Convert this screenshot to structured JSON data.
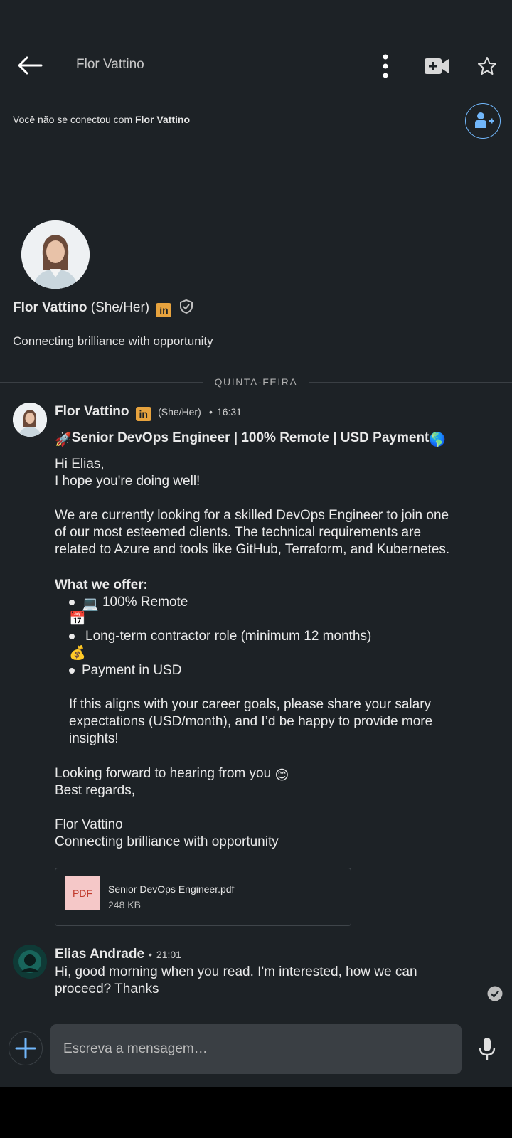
{
  "header": {
    "title": "Flor Vattino",
    "not_connected_prefix": "Você não se conectou com",
    "not_connected_name": "Flor Vattino"
  },
  "profile": {
    "name": "Flor Vattino",
    "pronouns": "(She/Her)",
    "headline": "Connecting brilliance with opportunity"
  },
  "day_label": "QUINTA-FEIRA",
  "message1": {
    "sender": "Flor Vattino",
    "pronouns": "(She/Her)",
    "time": "16:31",
    "subject": "Senior DevOps Engineer | 100% Remote | USD Payment",
    "lines": [
      "Hi Elias,",
      "I hope you're doing well!",
      "We are currently looking for a skilled DevOps Engineer to join one",
      "of our most esteemed clients. The technical requirements are",
      "related to Azure and tools like GitHub, Terraform, and Kubernetes."
    ],
    "offer_heading": "What we offer:",
    "offers": [
      "100% Remote",
      "Long-term contractor role (minimum 12 months)",
      "Payment in USD"
    ],
    "closing_lines": [
      "If this aligns with your career goals, please share your salary",
      "expectations (USD/month), and I’d be happy to provide more",
      "insights!"
    ],
    "signoff": [
      "Looking forward to hearing from you",
      "Best regards,",
      "Flor Vattino",
      "Connecting brilliance with opportunity"
    ]
  },
  "attachment": {
    "type_label": "PDF",
    "filename": "Senior DevOps Engineer.pdf",
    "size": "248 KB"
  },
  "message2": {
    "sender": "Elias Andrade",
    "time": "21:01",
    "lines": [
      "Hi, good morning when you read. I'm interested, how we can",
      "proceed? Thanks"
    ]
  },
  "composer": {
    "placeholder": "Escreva a mensagem…"
  },
  "colors": {
    "background": "#1d2226",
    "accent": "#71b7fb",
    "linkedin_badge": "#e7a33e"
  },
  "icons": [
    "back-arrow-icon",
    "more-options-icon",
    "video-call-icon",
    "star-icon",
    "add-connection-icon",
    "linkedin-icon",
    "verified-shield-icon",
    "rocket-icon",
    "globe-icon",
    "laptop-icon",
    "calendar-icon",
    "money-bag-icon",
    "smile-icon",
    "pdf-icon",
    "read-check-icon",
    "plus-icon",
    "microphone-icon"
  ]
}
